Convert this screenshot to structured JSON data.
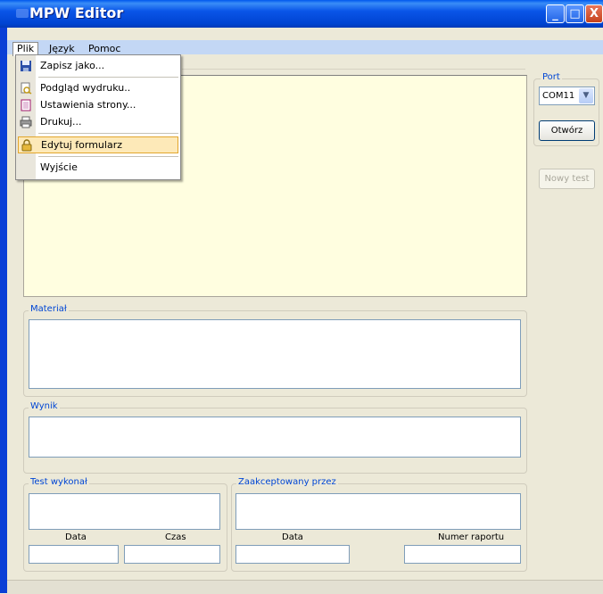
{
  "window": {
    "title": "MPW Editor",
    "minimize": "_",
    "maximize": "□",
    "close": "X"
  },
  "menubar": {
    "items": [
      {
        "label": "Plik"
      },
      {
        "label": "Język"
      },
      {
        "label": "Pomoc"
      }
    ]
  },
  "file_menu": {
    "items": [
      {
        "label": "Zapisz jako...",
        "icon": "save-icon"
      },
      {
        "label": "Podgląd wydruku..",
        "icon": "print-preview-icon"
      },
      {
        "label": "Ustawienia strony...",
        "icon": "page-setup-icon"
      },
      {
        "label": "Drukuj...",
        "icon": "printer-icon"
      },
      {
        "label": "Edytuj formularz",
        "icon": "lock-icon",
        "highlighted": true
      },
      {
        "label": "Wyjście",
        "icon": ""
      }
    ]
  },
  "port": {
    "label": "Port",
    "selected": "COM11",
    "open_button": "Otwórz",
    "new_test_button": "Nowy test"
  },
  "material": {
    "label": "Materiał",
    "value": ""
  },
  "result": {
    "label": "Wynik",
    "value": ""
  },
  "performed_by": {
    "label": "Test wykonał",
    "date_label": "Data",
    "time_label": "Czas"
  },
  "accepted_by": {
    "label": "Zaakceptowany przez",
    "date_label": "Data",
    "report_label": "Numer raportu"
  },
  "colors": {
    "titlebar": "#0054e3",
    "group_label": "#0046d5",
    "yellow_area": "#fffee0",
    "menu_highlight": "#fde9b8"
  }
}
